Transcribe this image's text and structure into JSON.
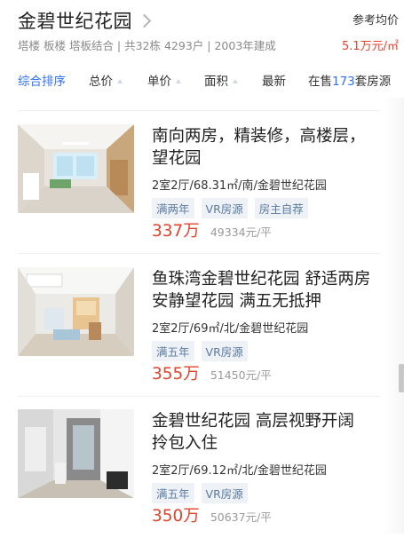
{
  "header": {
    "title": "金碧世纪花园",
    "subinfo": "塔楼 板楼 塔板结合 | 共32栋 4293户 | 2003年建成",
    "ref_label": "参考均价",
    "ref_price": "5.1万元/㎡"
  },
  "sort": {
    "comprehensive": "综合排序",
    "total_price": "总价",
    "unit_price": "单价",
    "area": "面积",
    "latest": "最新",
    "on_sale_prefix": "在售",
    "on_sale_count": "173",
    "on_sale_suffix": "套房源"
  },
  "listings": [
    {
      "title": "南向两房，精装修，高楼层，望花园",
      "meta": "2室2厅/68.31㎡/南/金碧世纪花园",
      "tags": [
        "满两年",
        "VR房源",
        "房主自荐"
      ],
      "price": "337万",
      "unit_price": "49334元/平"
    },
    {
      "title": "鱼珠湾金碧世纪花园 舒适两房 安静望花园 满五无抵押",
      "meta": "2室2厅/69㎡/北/金碧世纪花园",
      "tags": [
        "满五年",
        "VR房源"
      ],
      "price": "355万",
      "unit_price": "51450元/平"
    },
    {
      "title": "金碧世纪花园 高层视野开阔 拎包入住",
      "meta": "2室2厅/69.12㎡/北/金碧世纪花园",
      "tags": [
        "满五年",
        "VR房源"
      ],
      "price": "350万",
      "unit_price": "50637元/平"
    }
  ]
}
